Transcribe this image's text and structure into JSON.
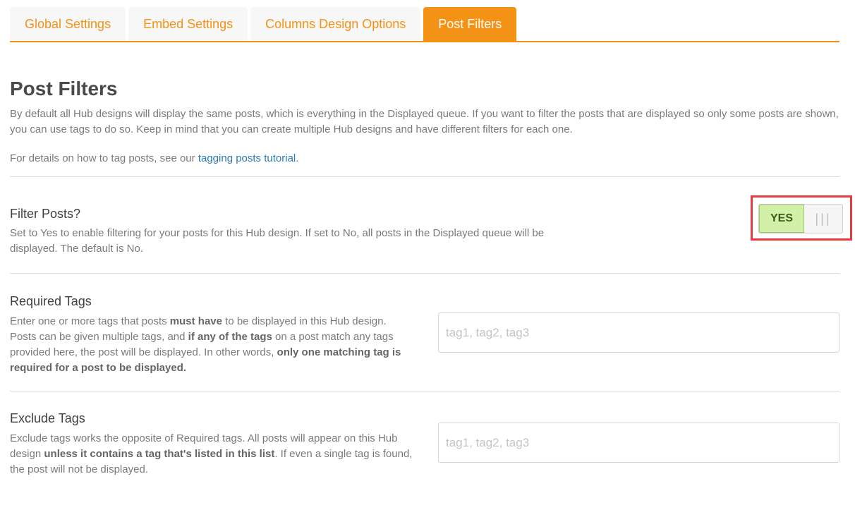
{
  "tabs": [
    {
      "label": "Global Settings",
      "active": false
    },
    {
      "label": "Embed Settings",
      "active": false
    },
    {
      "label": "Columns Design Options",
      "active": false
    },
    {
      "label": "Post Filters",
      "active": true
    }
  ],
  "header": {
    "title": "Post Filters",
    "intro": "By default all Hub designs will display the same posts, which is everything in the Displayed queue. If you want to filter the posts that are displayed so only some posts are shown, you can use tags to do so. Keep in mind that you can create multiple Hub designs and have different filters for each one.",
    "details_prefix": "For details on how to tag posts, see our ",
    "details_link": "tagging posts tutorial",
    "details_suffix": "."
  },
  "filter_posts": {
    "label": "Filter Posts?",
    "description": "Set to Yes to enable filtering for your posts for this Hub design. If set to No, all posts in the Displayed queue will be displayed. The default is No.",
    "toggle_label": "YES",
    "toggle_handle": "|||",
    "enabled": true
  },
  "required_tags": {
    "label": "Required Tags",
    "desc_1": "Enter one or more tags that posts ",
    "desc_b1": "must have",
    "desc_2": " to be displayed in this Hub design. Posts can be given multiple tags, and ",
    "desc_b2": "if any of the tags",
    "desc_3": " on a post match any tags provided here, the post will be displayed. In other words, ",
    "desc_b3": "only one matching tag is required for a post to be displayed.",
    "placeholder": "tag1, tag2, tag3",
    "value": ""
  },
  "exclude_tags": {
    "label": "Exclude Tags",
    "desc_1": "Exclude tags works the opposite of Required tags. All posts will appear on this Hub design ",
    "desc_b1": "unless it contains a tag that's listed in this list",
    "desc_2": ". If even a single tag is found, the post will not be displayed.",
    "placeholder": "tag1, tag2, tag3",
    "value": ""
  },
  "colors": {
    "accent": "#f39214",
    "link": "#2a7ab8",
    "toggle_on": "#d3f0a9",
    "highlight": "#e8393f"
  }
}
